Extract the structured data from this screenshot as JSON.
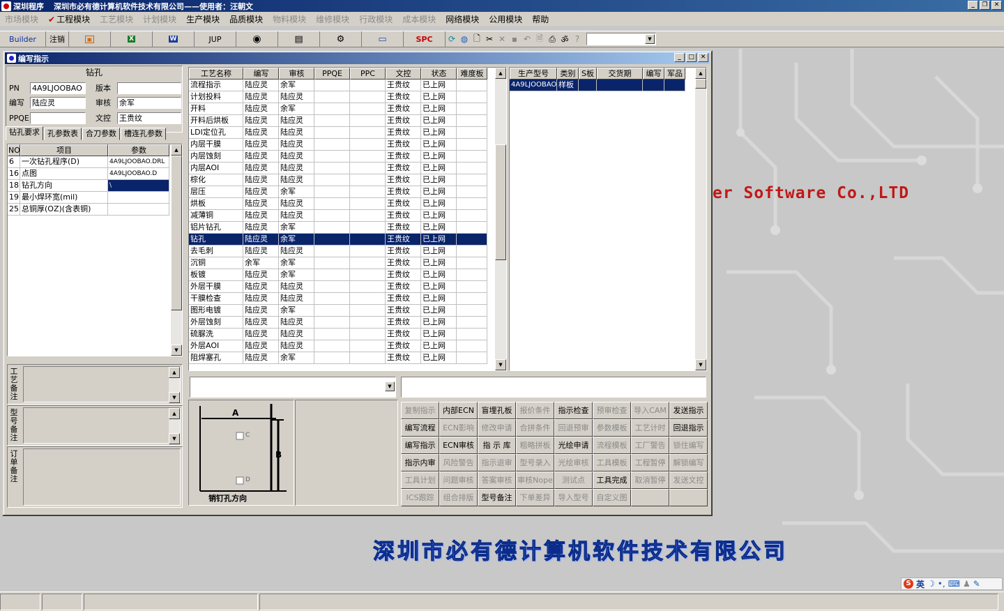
{
  "app": {
    "title_short": "深圳程序",
    "title_company": "深圳市必有德计算机软件技术有限公司——使用者：汪朝文"
  },
  "menu": [
    {
      "label": "市场模块",
      "enabled": false
    },
    {
      "label": "工程模块",
      "enabled": true,
      "checked": true
    },
    {
      "label": "工艺模块",
      "enabled": false
    },
    {
      "label": "计划模块",
      "enabled": false
    },
    {
      "label": "生产模块",
      "enabled": true
    },
    {
      "label": "品质模块",
      "enabled": true
    },
    {
      "label": "物料模块",
      "enabled": false
    },
    {
      "label": "维修模块",
      "enabled": false
    },
    {
      "label": "行政模块",
      "enabled": false
    },
    {
      "label": "成本模块",
      "enabled": false
    },
    {
      "label": "网络模块",
      "enabled": true
    },
    {
      "label": "公用模块",
      "enabled": true
    },
    {
      "label": "帮助",
      "enabled": true
    }
  ],
  "toolbar": {
    "builder": "Builder",
    "logout": "注销",
    "jup": "JUP",
    "spc": "SPC"
  },
  "background": {
    "slogan": "er Software Co.,LTD",
    "company_big": "深圳市必有德计算机软件技术有限公司"
  },
  "ime": {
    "lang": "英",
    "logo": "S"
  },
  "child": {
    "title": "编写指示",
    "section_title": "钻孔",
    "fields": {
      "pn_label": "PN",
      "pn_value": "4A9LJOOBAO",
      "version_label": "版本",
      "version_value": "",
      "writer_label": "编写",
      "writer_value": "陆应灵",
      "reviewer_label": "审核",
      "reviewer_value": "余军",
      "ppqe_label": "PPQE",
      "ppqe_value": "",
      "doc_label": "文控",
      "doc_value": "王贵纹"
    },
    "tabs": [
      "钻孔要求",
      "孔参数表",
      "合刀参数",
      "槽连孔参数"
    ],
    "param_grid": {
      "headers": [
        "NO",
        "项目",
        "参数"
      ],
      "rows": [
        [
          "6",
          "一次钻孔程序(D)",
          "4A9LJOOBAO.DRL"
        ],
        [
          "16",
          "点图",
          "4A9LJOOBAO.D"
        ],
        [
          "18",
          "钻孔方向",
          "\\"
        ],
        [
          "19",
          "最小焊环宽(mil)",
          ""
        ],
        [
          "25",
          "总铜厚(OZ)(含表铜)",
          ""
        ]
      ]
    },
    "memo_labels": [
      "工艺备注",
      "型号备注",
      "订单备注"
    ],
    "process_grid": {
      "headers": [
        "工艺名称",
        "编写",
        "审核",
        "PPQE",
        "PPC",
        "文控",
        "状态",
        "难度板"
      ],
      "rows": [
        [
          "流程指示",
          "陆应灵",
          "余军",
          "",
          "",
          "王贵纹",
          "已上网",
          ""
        ],
        [
          "计划投料",
          "陆应灵",
          "陆应灵",
          "",
          "",
          "王贵纹",
          "已上网",
          ""
        ],
        [
          "开料",
          "陆应灵",
          "余军",
          "",
          "",
          "王贵纹",
          "已上网",
          ""
        ],
        [
          "开料后烘板",
          "陆应灵",
          "陆应灵",
          "",
          "",
          "王贵纹",
          "已上网",
          ""
        ],
        [
          "LDI定位孔",
          "陆应灵",
          "陆应灵",
          "",
          "",
          "王贵纹",
          "已上网",
          ""
        ],
        [
          "内层干膜",
          "陆应灵",
          "陆应灵",
          "",
          "",
          "王贵纹",
          "已上网",
          ""
        ],
        [
          "内层蚀刻",
          "陆应灵",
          "陆应灵",
          "",
          "",
          "王贵纹",
          "已上网",
          ""
        ],
        [
          "内层AOI",
          "陆应灵",
          "陆应灵",
          "",
          "",
          "王贵纹",
          "已上网",
          ""
        ],
        [
          "棕化",
          "陆应灵",
          "陆应灵",
          "",
          "",
          "王贵纹",
          "已上网",
          ""
        ],
        [
          "层压",
          "陆应灵",
          "余军",
          "",
          "",
          "王贵纹",
          "已上网",
          ""
        ],
        [
          "烘板",
          "陆应灵",
          "陆应灵",
          "",
          "",
          "王贵纹",
          "已上网",
          ""
        ],
        [
          "减薄铜",
          "陆应灵",
          "陆应灵",
          "",
          "",
          "王贵纹",
          "已上网",
          ""
        ],
        [
          "铝片钻孔",
          "陆应灵",
          "余军",
          "",
          "",
          "王贵纹",
          "已上网",
          ""
        ],
        [
          "钻孔",
          "陆应灵",
          "余军",
          "",
          "",
          "王贵纹",
          "已上网",
          ""
        ],
        [
          "去毛刺",
          "陆应灵",
          "陆应灵",
          "",
          "",
          "王贵纹",
          "已上网",
          ""
        ],
        [
          "沉铜",
          "余军",
          "余军",
          "",
          "",
          "王贵纹",
          "已上网",
          ""
        ],
        [
          "板镀",
          "陆应灵",
          "余军",
          "",
          "",
          "王贵纹",
          "已上网",
          ""
        ],
        [
          "外层干膜",
          "陆应灵",
          "陆应灵",
          "",
          "",
          "王贵纹",
          "已上网",
          ""
        ],
        [
          "干膜检查",
          "陆应灵",
          "陆应灵",
          "",
          "",
          "王贵纹",
          "已上网",
          ""
        ],
        [
          "图形电镀",
          "陆应灵",
          "余军",
          "",
          "",
          "王贵纹",
          "已上网",
          ""
        ],
        [
          "外层蚀刻",
          "陆应灵",
          "陆应灵",
          "",
          "",
          "王贵纹",
          "已上网",
          ""
        ],
        [
          "硫脲洗",
          "陆应灵",
          "陆应灵",
          "",
          "",
          "王贵纹",
          "已上网",
          ""
        ],
        [
          "外层AOI",
          "陆应灵",
          "陆应灵",
          "",
          "",
          "王贵纹",
          "已上网",
          ""
        ],
        [
          "阻焊塞孔",
          "陆应灵",
          "余军",
          "",
          "",
          "王贵纹",
          "已上网",
          ""
        ]
      ],
      "selected_index": 13
    },
    "model_grid": {
      "headers": [
        "生产型号",
        "类别",
        "S板",
        "交货期",
        "编写",
        "军品"
      ],
      "rows": [
        [
          "4A9LJOOBAO",
          "样板",
          "",
          "",
          "",
          ""
        ]
      ]
    },
    "diagram": {
      "label_a": "A",
      "label_b": "B",
      "label_c": "C",
      "label_d": "D",
      "caption": "销钉孔方向"
    },
    "buttons": [
      {
        "label": "复制指示",
        "enabled": false
      },
      {
        "label": "内部ECN",
        "enabled": true
      },
      {
        "label": "盲埋孔板",
        "enabled": true
      },
      {
        "label": "报价条件",
        "enabled": false
      },
      {
        "label": "指示检查",
        "enabled": true
      },
      {
        "label": "预审检查",
        "enabled": false
      },
      {
        "label": "导入CAM",
        "enabled": false
      },
      {
        "label": "发送指示",
        "enabled": true
      },
      {
        "label": "编写流程",
        "enabled": true
      },
      {
        "label": "ECN影响",
        "enabled": false
      },
      {
        "label": "修改申请",
        "enabled": false
      },
      {
        "label": "合拼条件",
        "enabled": false
      },
      {
        "label": "回退预审",
        "enabled": false
      },
      {
        "label": "参数模板",
        "enabled": false
      },
      {
        "label": "工艺计时",
        "enabled": false
      },
      {
        "label": "回退指示",
        "enabled": true
      },
      {
        "label": "编写指示",
        "enabled": true
      },
      {
        "label": "ECN审核",
        "enabled": true
      },
      {
        "label": "指 示 库",
        "enabled": true
      },
      {
        "label": "粗略拼板",
        "enabled": false
      },
      {
        "label": "光绘申请",
        "enabled": true
      },
      {
        "label": "流程模板",
        "enabled": false
      },
      {
        "label": "工厂警告",
        "enabled": false
      },
      {
        "label": "锁住编写",
        "enabled": false
      },
      {
        "label": "指示内审",
        "enabled": true
      },
      {
        "label": "风险警告",
        "enabled": false
      },
      {
        "label": "指示退审",
        "enabled": false
      },
      {
        "label": "型号录入",
        "enabled": false
      },
      {
        "label": "光绘审核",
        "enabled": false
      },
      {
        "label": "工具模板",
        "enabled": false
      },
      {
        "label": "工程暂停",
        "enabled": false
      },
      {
        "label": "解锁编写",
        "enabled": false
      },
      {
        "label": "工具计划",
        "enabled": false
      },
      {
        "label": "问题审核",
        "enabled": false
      },
      {
        "label": "答案审核",
        "enabled": false
      },
      {
        "label": "审核Nope",
        "enabled": false
      },
      {
        "label": "测试点",
        "enabled": false
      },
      {
        "label": "工具完成",
        "enabled": true
      },
      {
        "label": "取消暂停",
        "enabled": false
      },
      {
        "label": "发送文控",
        "enabled": false
      },
      {
        "label": "ICS跟踪",
        "enabled": false
      },
      {
        "label": "组合排版",
        "enabled": false
      },
      {
        "label": "型号备注",
        "enabled": true
      },
      {
        "label": "下单差异",
        "enabled": false
      },
      {
        "label": "导入型号",
        "enabled": false
      },
      {
        "label": "自定义图",
        "enabled": false
      },
      {
        "label": "",
        "enabled": false
      },
      {
        "label": "",
        "enabled": false
      }
    ]
  }
}
